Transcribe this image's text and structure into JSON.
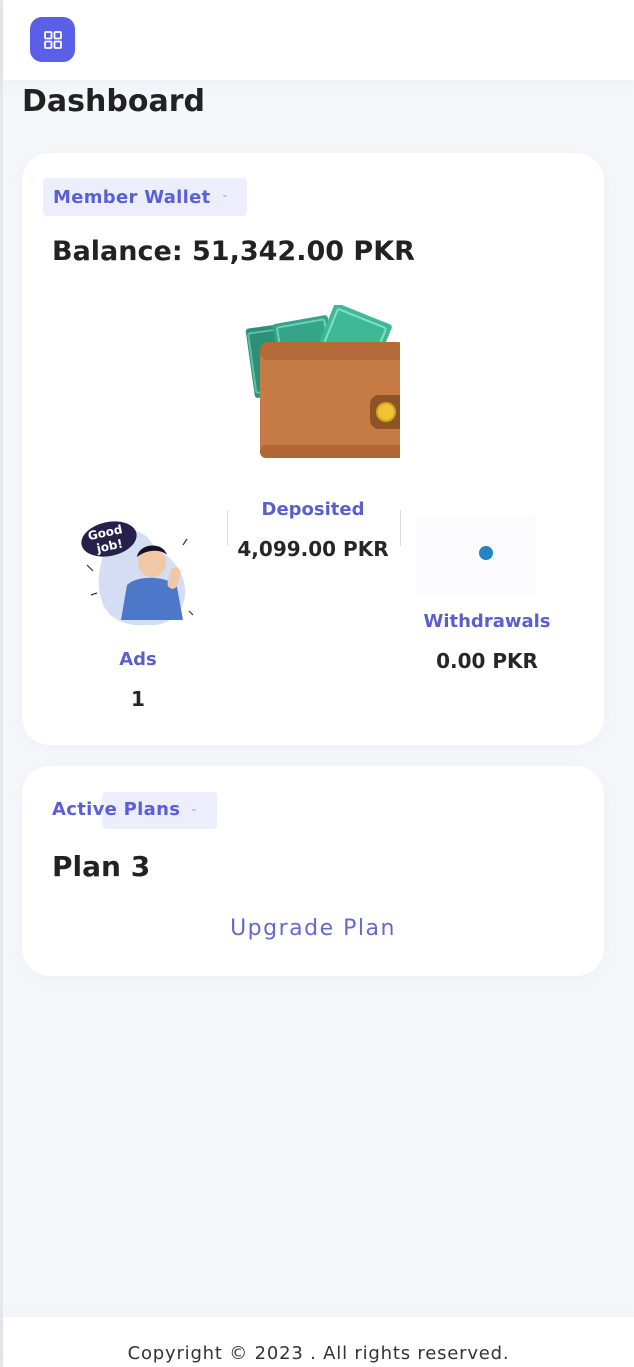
{
  "page": {
    "title": "Dashboard"
  },
  "header": {
    "menu_icon": "grid-icon",
    "accent_color": "#5a5fe8"
  },
  "wallet_card": {
    "chip_label": "Member Wallet",
    "balance": "Balance: 51,342.00 PKR",
    "illustration": "wallet-with-cash-icon",
    "deposited": {
      "label": "Deposited",
      "value": "4,099.00 PKR"
    },
    "withdrawals": {
      "label": "Withdrawals",
      "value": "0.00 PKR"
    },
    "ads": {
      "label": "Ads",
      "value": "1",
      "illustration": "good-job-illustration"
    }
  },
  "plans_card": {
    "chip_label": "Active Plans",
    "plan_name": "Plan 3",
    "upgrade_label": "Upgrade Plan"
  },
  "footer": {
    "copyright": "Copyright © 2023 . All rights reserved."
  }
}
